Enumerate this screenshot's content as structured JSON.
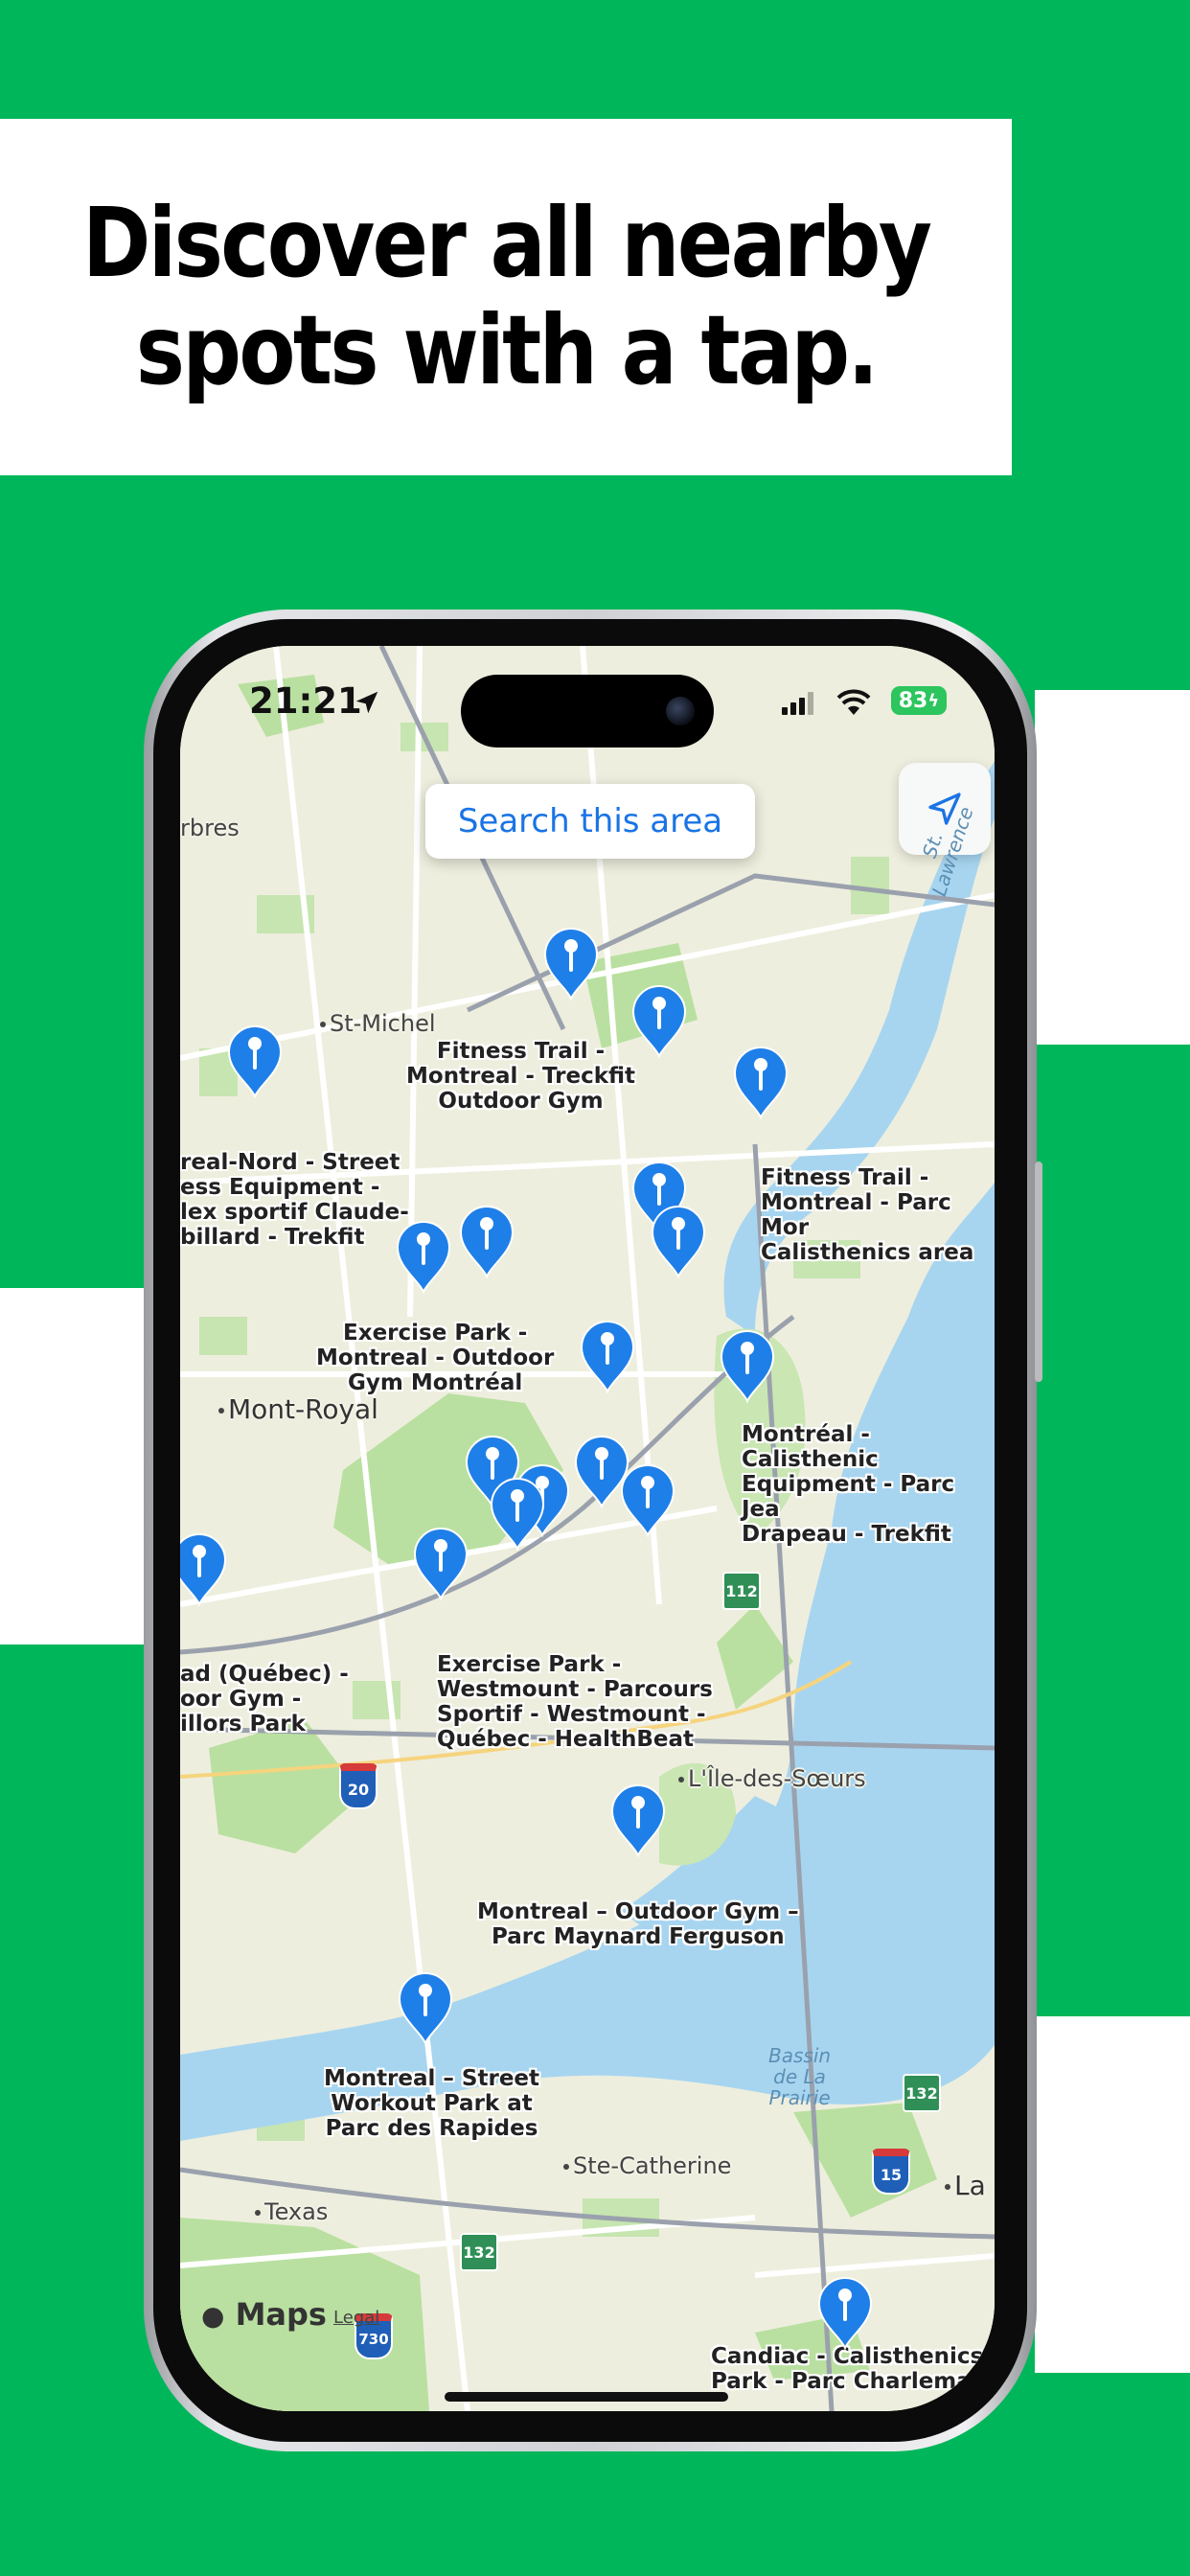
{
  "promo": {
    "headline": "Discover all nearby\nspots with a tap."
  },
  "status_bar": {
    "time": "21:21",
    "battery": "83"
  },
  "map": {
    "search_label": "Search this area",
    "attribution": "Maps",
    "legal": "Legal",
    "places": [
      {
        "id": "arbres",
        "text": "rbres"
      },
      {
        "id": "st-michel",
        "text": "St-Michel"
      },
      {
        "id": "mont-royal",
        "text": "Mont-Royal"
      },
      {
        "id": "ile-des-soeurs",
        "text": "L'Île-des-Sœurs"
      },
      {
        "id": "ste-catherine",
        "text": "Ste-Catherine"
      },
      {
        "id": "texas",
        "text": "Texas"
      },
      {
        "id": "la",
        "text": "La"
      }
    ],
    "water_labels": {
      "st_lawrence": "St. Lawrence",
      "bassin": "Bassin\nde La\nPrairie"
    },
    "highway_shields": [
      "112",
      "20",
      "132",
      "15",
      "132",
      "730"
    ],
    "spot_labels": [
      "Fitness Trail -\nMontreal - Treckfit\nOutdoor Gym",
      "real-Nord - Street\ness Equipment -\nlex sportif Claude-\nbillard - Trekfit",
      "Fitness Trail -\nMontreal - Parc Mor\nCalisthenics area",
      "Exercise Park -\nMontreal - Outdoor\nGym Montréal",
      "Montréal - Calisthenic\nEquipment - Parc Jea\nDrapeau - Trekfit",
      "ad (Québec) -\noor Gym -\nillors Park",
      "Exercise Park -\nWestmount - Parcours\nSportif - Westmount -\nQuébec - HealthBeat",
      "Montreal – Outdoor Gym –\nParc Maynard Ferguson",
      "Montreal – Street\nWorkout Park at\nParc des Rapides",
      "Candiac - Calisthenics\nPark - Parc Charlemag"
    ],
    "pin_color": "#1f7fe8"
  }
}
